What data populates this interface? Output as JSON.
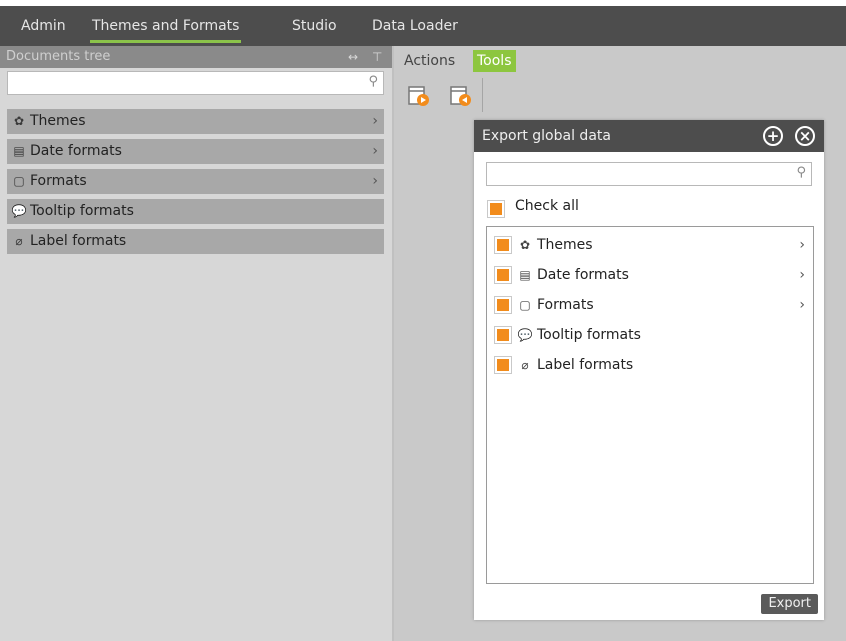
{
  "nav": {
    "tabs": [
      "Admin",
      "Themes and Formats",
      "Studio",
      "Data Loader"
    ],
    "active_tab": "Themes and Formats"
  },
  "documents_tree": {
    "title": "Documents tree",
    "header_icons": [
      "expand-horizontal-icon",
      "pin-icon"
    ],
    "search_placeholder": "",
    "items": [
      {
        "label": "Themes",
        "icon": "palette-icon",
        "has_children": true
      },
      {
        "label": "Date formats",
        "icon": "calendar-icon",
        "has_children": true
      },
      {
        "label": "Formats",
        "icon": "document-icon",
        "has_children": true
      },
      {
        "label": "Tooltip formats",
        "icon": "speech-bubble-icon",
        "has_children": false
      },
      {
        "label": "Label formats",
        "icon": "tag-icon",
        "has_children": false
      }
    ]
  },
  "right_panel": {
    "tabs": [
      "Actions",
      "Tools"
    ],
    "active_tab": "Tools",
    "toolbar": [
      "export-icon",
      "import-icon"
    ]
  },
  "export_dialog": {
    "title": "Export global data",
    "search_placeholder": "",
    "check_all_label": "Check all",
    "items": [
      {
        "label": "Themes",
        "icon": "palette-icon",
        "checked": true,
        "has_children": true
      },
      {
        "label": "Date formats",
        "icon": "calendar-icon",
        "checked": true,
        "has_children": true
      },
      {
        "label": "Formats",
        "icon": "document-icon",
        "checked": true,
        "has_children": true
      },
      {
        "label": "Tooltip formats",
        "icon": "speech-bubble-icon",
        "checked": true,
        "has_children": false
      },
      {
        "label": "Label formats",
        "icon": "tag-icon",
        "checked": true,
        "has_children": false
      }
    ],
    "export_label": "Export"
  },
  "colors": {
    "accent_green": "#8dc63f",
    "checkbox_orange": "#f28c1c",
    "topbar": "#4d4d4d"
  }
}
